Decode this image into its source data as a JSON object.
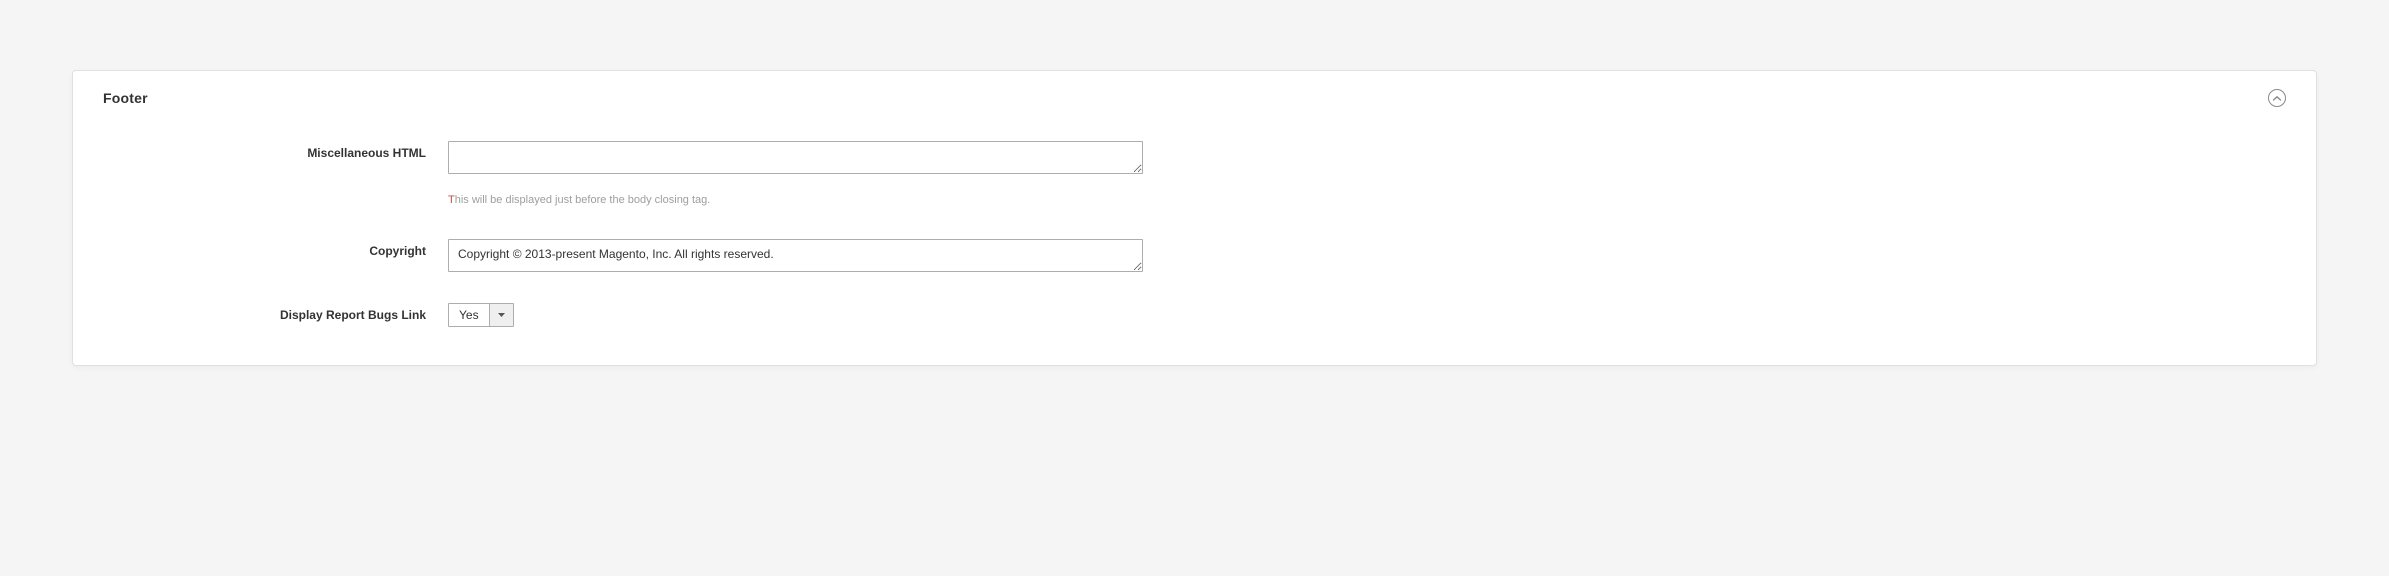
{
  "section": {
    "title": "Footer"
  },
  "fields": {
    "misc_html": {
      "label": "Miscellaneous HTML",
      "value": "",
      "note": "This will be displayed just before the body closing tag."
    },
    "copyright": {
      "label": "Copyright",
      "value": "Copyright © 2013-present Magento, Inc. All rights reserved."
    },
    "display_bugs": {
      "label": "Display Report Bugs Link",
      "value": "Yes"
    }
  }
}
